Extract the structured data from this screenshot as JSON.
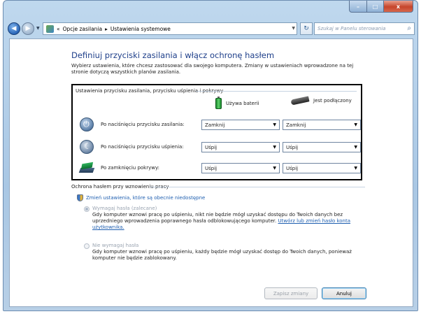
{
  "window": {
    "caption": {
      "minimize": "–",
      "maximize": "□",
      "close": "x"
    }
  },
  "nav": {
    "back_icon": "back-arrow-icon",
    "forward_icon": "forward-arrow-icon",
    "breadcrumb": [
      "«",
      "Opcje zasilania",
      "▸",
      "Ustawienia systemowe"
    ],
    "search_placeholder": "Szukaj w Panelu sterowania"
  },
  "page": {
    "title": "Definiuj przyciski zasilania i włącz ochronę hasłem",
    "description": "Wybierz ustawienia, które chcesz zastosować dla swojego komputera. Zmiany w ustawieniach wprowadzone na tej stronie dotyczą wszystkich planów zasilania."
  },
  "power_buttons": {
    "section_title": "Ustawienia przycisku zasilania, przycisku uśpienia i pokrywy",
    "columns": [
      {
        "label": "Używa baterii",
        "icon": "battery-icon"
      },
      {
        "label": "Jest podłączony",
        "icon": "plug-icon"
      }
    ],
    "rows": [
      {
        "label": "Po naciśnięciu przycisku zasilania:",
        "icon": "power-button-icon",
        "battery": "Zamknij",
        "plugged": "Zamknij"
      },
      {
        "label": "Po naciśnięciu przycisku uśpienia:",
        "icon": "sleep-button-icon",
        "battery": "Uśpij",
        "plugged": "Uśpij"
      },
      {
        "label": "Po zamknięciu pokrywy:",
        "icon": "laptop-lid-icon",
        "battery": "Uśpij",
        "plugged": "Uśpij"
      }
    ]
  },
  "password": {
    "section_title": "Ochrona hasłem przy wznowieniu pracy",
    "change_link": "Zmień ustawienia, które są obecnie niedostępne",
    "require": {
      "label": "Wymagaj hasła (zalecane)",
      "desc": "Gdy komputer wznowi pracę po uśpieniu, nikt nie będzie mógł uzyskać dostępu do Twoich danych bez uprzedniego wprowadzenia poprawnego hasła odblokowującego komputer.",
      "link": "Utwórz lub zmień hasło konta użytkownika."
    },
    "no_require": {
      "label": "Nie wymagaj hasła",
      "desc": "Gdy komputer wznowi pracę po uśpieniu, każdy będzie mógł uzyskać dostęp do Twoich danych, ponieważ komputer nie będzie zablokowany."
    }
  },
  "footer": {
    "save": "Zapisz zmiany",
    "cancel": "Anuluj"
  }
}
